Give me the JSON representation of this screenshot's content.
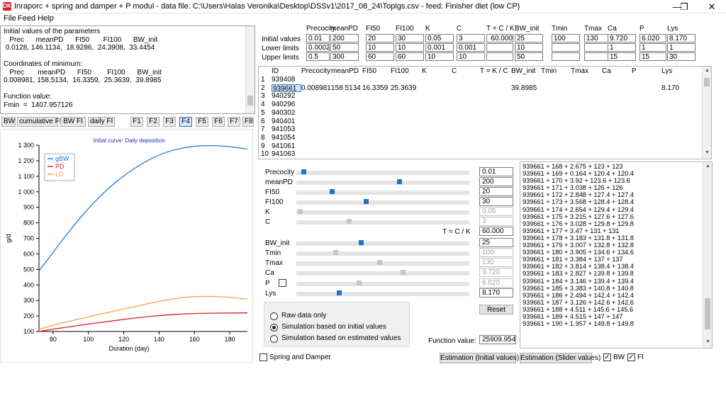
{
  "window": {
    "title": "Inraporc + spring and damper + P modul    - data file: C:\\Users\\Halas Veronika\\Desktop\\DSSv1\\2017_08_24\\Topigs.csv     - feed: Finisher diet (low CP)",
    "minimize": "—",
    "maximize": "❐",
    "close": "✕"
  },
  "menu": [
    "File",
    "Feed",
    "Help"
  ],
  "textarea": "Initial values of the parameters\n   Prec      meanPD      FI50       FI100      BW_init\n 0.0128, 146.1134,  18.9286,  24.3908,  33.4454\n\nCoordinates of minimum:\n   Prec       meanPD      FI50        FI100      BW_init\n0.008981, 158.5134,  16.3359,  25.3639,  39.8985\n\nFunction value:\nFmin  =  1407.957126",
  "tabs": [
    "BW",
    "cumulative FI",
    "BW FI",
    "daily FI",
    "F1",
    "F2",
    "F3",
    "F4",
    "F5",
    "F6",
    "F7",
    "F8"
  ],
  "selected_tab": "F4",
  "params": {
    "headers": [
      "Precocity",
      "meanPD",
      "FI50",
      "FI100",
      "K",
      "C",
      "T = C / K",
      "BW_init",
      "Tmin",
      "Tmax",
      "Ca",
      "P",
      "Lys"
    ],
    "row_labels": [
      "Initial values",
      "Lower limits",
      "Upper limits"
    ],
    "initial": [
      "0.01",
      "200",
      "20",
      "30",
      "0.05",
      "3",
      "60.000",
      "25",
      "100",
      "130",
      "9.720",
      "6.020",
      "8.170"
    ],
    "lower": [
      "0.0002",
      "50",
      "10",
      "10",
      "0.001",
      "0.001",
      "",
      "10",
      "",
      "",
      "1",
      "1",
      "1"
    ],
    "upper": [
      "0.5",
      "300",
      "60",
      "60",
      "10",
      "10",
      "",
      "50",
      "",
      "",
      "15",
      "15",
      "30"
    ]
  },
  "grid": {
    "headers": [
      "ID",
      "Precocity",
      "meanPD",
      "FI50",
      "FI100",
      "K",
      "C",
      "T = K / C",
      "BW_init",
      "Tmin",
      "Tmax",
      "Ca",
      "P",
      "Lys"
    ],
    "rows": [
      {
        "n": "1",
        "id": "939408",
        "vals": [
          "",
          "",
          "",
          "",
          "",
          "",
          "",
          "",
          "",
          "",
          "",
          "",
          ""
        ]
      },
      {
        "n": "2",
        "id": "939661",
        "vals": [
          "0.008981",
          "158.5134",
          "16.3359",
          "25.3639",
          "",
          "",
          "",
          "39.8985",
          "",
          "",
          "",
          "",
          "8.170"
        ]
      },
      {
        "n": "3",
        "id": "940292",
        "vals": [
          "",
          "",
          "",
          "",
          "",
          "",
          "",
          "",
          "",
          "",
          "",
          "",
          ""
        ]
      },
      {
        "n": "4",
        "id": "940296",
        "vals": [
          "",
          "",
          "",
          "",
          "",
          "",
          "",
          "",
          "",
          "",
          "",
          "",
          ""
        ]
      },
      {
        "n": "5",
        "id": "940302",
        "vals": [
          "",
          "",
          "",
          "",
          "",
          "",
          "",
          "",
          "",
          "",
          "",
          "",
          ""
        ]
      },
      {
        "n": "6",
        "id": "940401",
        "vals": [
          "",
          "",
          "",
          "",
          "",
          "",
          "",
          "",
          "",
          "",
          "",
          "",
          ""
        ]
      },
      {
        "n": "7",
        "id": "941053",
        "vals": [
          "",
          "",
          "",
          "",
          "",
          "",
          "",
          "",
          "",
          "",
          "",
          "",
          ""
        ]
      },
      {
        "n": "8",
        "id": "941054",
        "vals": [
          "",
          "",
          "",
          "",
          "",
          "",
          "",
          "",
          "",
          "",
          "",
          "",
          ""
        ]
      },
      {
        "n": "9",
        "id": "941061",
        "vals": [
          "",
          "",
          "",
          "",
          "",
          "",
          "",
          "",
          "",
          "",
          "",
          "",
          ""
        ]
      },
      {
        "n": "10",
        "id": "941063",
        "vals": [
          "",
          "",
          "",
          "",
          "",
          "",
          "",
          "",
          "",
          "",
          "",
          "",
          ""
        ]
      }
    ]
  },
  "sliders": [
    {
      "label": "Precocity",
      "value": "0.01",
      "level": 0.03,
      "enabled": true
    },
    {
      "label": "meanPD",
      "value": "200",
      "level": 0.6,
      "enabled": true
    },
    {
      "label": "FI50",
      "value": "20",
      "level": 0.2,
      "enabled": true
    },
    {
      "label": "FI100",
      "value": "30",
      "level": 0.4,
      "enabled": true
    },
    {
      "label": "K",
      "value": "0.05",
      "level": 0.01,
      "enabled": false
    },
    {
      "label": "C",
      "value": "3",
      "level": 0.3,
      "enabled": false
    },
    {
      "label": "BW_init",
      "value": "25",
      "level": 0.37,
      "enabled": true
    },
    {
      "label": "Tmin",
      "value": "100",
      "level": 0.22,
      "enabled": false
    },
    {
      "label": "Tmax",
      "value": "130",
      "level": 0.48,
      "enabled": false
    },
    {
      "label": "Ca",
      "value": "9.720",
      "level": 0.62,
      "enabled": false
    },
    {
      "label": "P",
      "value": "6.020",
      "level": 0.36,
      "enabled": false
    },
    {
      "label": "Lys",
      "value": "8.170",
      "level": 0.24,
      "enabled": true
    }
  ],
  "t_label": "T = C / K",
  "t_value": "60.000",
  "reset_label": "Reset",
  "radios": [
    {
      "label": "Raw data only",
      "checked": false
    },
    {
      "label": "Simulation based on initial values",
      "checked": true
    },
    {
      "label": "Simulation based on estimated values",
      "checked": false
    }
  ],
  "function_value_label": "Function value:",
  "function_value": "25909.954",
  "log_lines": [
    "939661 + 168 + 2.675 + 123 + 123",
    "939661 + 169 + 0.164 + 120.4 + 120.4",
    "939661 + 170 + 3.92 + 123.6 + 123.6",
    "939661 + 171 + 3.038 + 126 + 126",
    "939661 + 172 + 2.848 + 127.4 + 127.4",
    "939661 + 173 + 3.568 + 128.4 + 128.4",
    "939661 + 174 + 2.654 + 129.4 + 129.4",
    "939661 + 175 + 3.215 + 127.6 + 127.6",
    "939661 + 176 + 3.028 + 129.8 + 129.8",
    "939661 + 177 + 3.47 + 131 + 131",
    "939661 + 178 + 3.183 + 131.8 + 131.8",
    "939661 + 179 + 3.007 + 132.8 + 132.8",
    "939661 + 180 + 3.905 + 134.6 + 134.6",
    "939661 + 181 + 3.384 + 137 + 137",
    "939661 + 182 + 3.814 + 138.4 + 138.4",
    "939661 + 183 + 2.827 + 139.8 + 139.8",
    "939661 + 184 + 3.146 + 139.4 + 139.4",
    "939661 + 185 + 3.383 + 140.8 + 140.8",
    "939661 + 186 + 2.494 + 142.4 + 142.4",
    "939661 + 187 + 3.126 + 142.6 + 142.6",
    "939661 + 188 + 4.511 + 145.6 + 145.6",
    "939661 + 189 + 4.515 + 147 + 147",
    "939661 + 190 + 1.957 + 149.8 + 149.8"
  ],
  "bottom": {
    "spring_label": "Spring and Damper",
    "spring_checked": false,
    "est_initial": "Estimation (Initial values)",
    "est_slider": "Estimation (Slider values)",
    "bw_label": "BW",
    "bw_checked": true,
    "fi_label": "FI",
    "fi_checked": true
  },
  "chart_data": {
    "type": "line",
    "title": "Initial curve: Daily deposition",
    "xlabel": "Duration (day)",
    "ylabel": "g/d",
    "xlim": [
      72,
      190
    ],
    "ylim": [
      100,
      1300
    ],
    "xticks": [
      80,
      100,
      120,
      140,
      160,
      180
    ],
    "yticks": [
      100,
      200,
      300,
      400,
      500,
      600,
      700,
      800,
      900,
      1000,
      1100,
      1200,
      1300
    ],
    "ytick_labels": [
      "100",
      "200",
      "300",
      "400",
      "500",
      "600",
      "700",
      "800",
      "900",
      "1 000",
      "1 100",
      "1 200",
      "1 300"
    ],
    "legend_position": "top-left",
    "series": [
      {
        "name": "gBW",
        "color": "#1e7ad6",
        "x": [
          72,
          80,
          90,
          100,
          110,
          120,
          130,
          140,
          150,
          160,
          170,
          180,
          190
        ],
        "y": [
          490,
          610,
          760,
          895,
          1010,
          1105,
          1180,
          1240,
          1275,
          1295,
          1298,
          1292,
          1275
        ]
      },
      {
        "name": "PD",
        "color": "#d42020",
        "x": [
          72,
          80,
          90,
          100,
          110,
          120,
          130,
          140,
          150,
          160,
          170,
          180,
          190
        ],
        "y": [
          100,
          115,
          132,
          148,
          163,
          178,
          192,
          203,
          211,
          216,
          218,
          219,
          220
        ]
      },
      {
        "name": "LD",
        "color": "#f5a34a",
        "x": [
          72,
          80,
          90,
          100,
          110,
          120,
          130,
          140,
          150,
          160,
          170,
          180,
          190
        ],
        "y": [
          115,
          140,
          168,
          195,
          220,
          245,
          270,
          295,
          315,
          326,
          327,
          320,
          308
        ]
      }
    ]
  }
}
